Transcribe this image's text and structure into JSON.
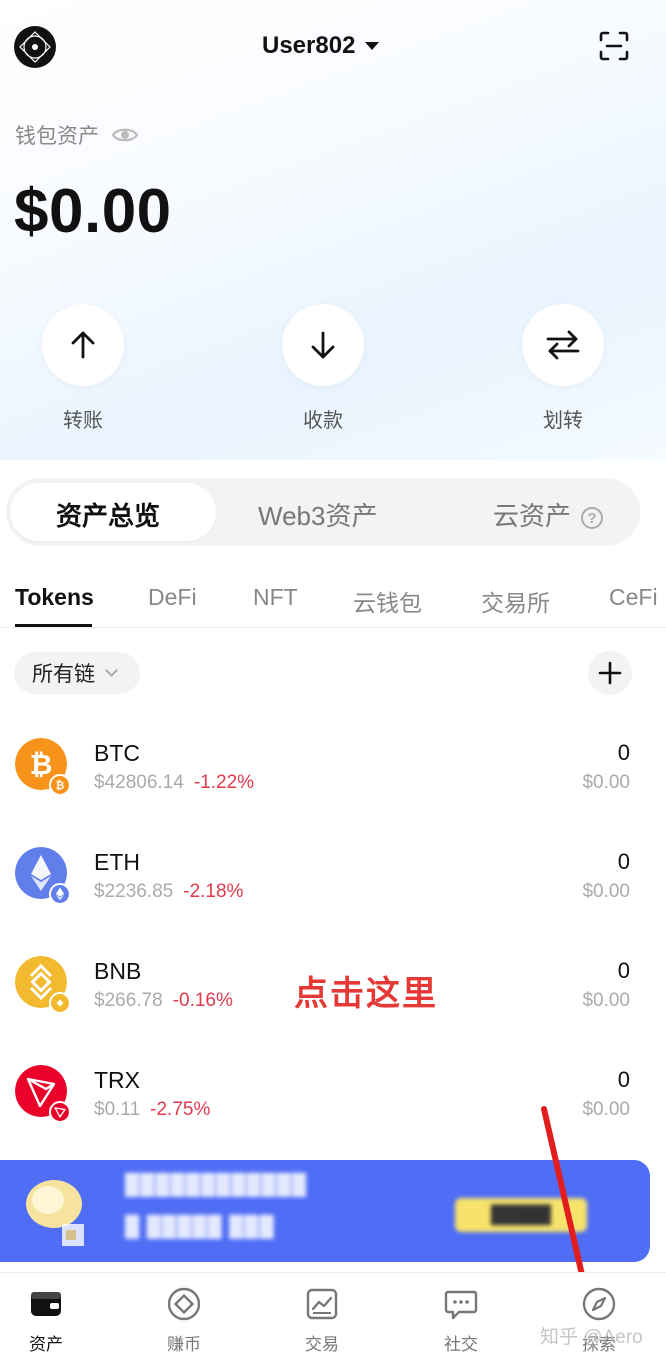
{
  "header": {
    "username": "User802",
    "icons": {
      "logo": "app-logo-icon",
      "scan": "scan-icon",
      "caret": "caret-down-icon"
    }
  },
  "wallet": {
    "label": "钱包资产",
    "balance": "$0.00",
    "visibility_icon": "eye-icon"
  },
  "actions": [
    {
      "label": "转账",
      "icon": "arrow-up-icon"
    },
    {
      "label": "收款",
      "icon": "arrow-down-icon"
    },
    {
      "label": "划转",
      "icon": "swap-icon"
    }
  ],
  "segments": {
    "items": [
      "资产总览",
      "Web3资产",
      "云资产"
    ],
    "active": "资产总览",
    "help_icon": "help-icon",
    "help_glyph": "?"
  },
  "subtabs": {
    "items": [
      "Tokens",
      "DeFi",
      "NFT",
      "云钱包",
      "交易所",
      "CeFi"
    ],
    "active": "Tokens"
  },
  "filter": {
    "chain_label": "所有链",
    "add_glyph": "+"
  },
  "tokens": [
    {
      "symbol": "BTC",
      "price": "$42806.14",
      "change": "-1.22%",
      "amount": "0",
      "value": "$0.00",
      "color": "#f7931a"
    },
    {
      "symbol": "ETH",
      "price": "$2236.85",
      "change": "-2.18%",
      "amount": "0",
      "value": "$0.00",
      "color": "#627eea"
    },
    {
      "symbol": "BNB",
      "price": "$266.78",
      "change": "-0.16%",
      "amount": "0",
      "value": "$0.00",
      "color": "#f3ba2f"
    },
    {
      "symbol": "TRX",
      "price": "$0.11",
      "change": "-2.75%",
      "amount": "0",
      "value": "$0.00",
      "color": "#eb0029"
    }
  ],
  "annotation": "点击这里",
  "banner": {
    "line1": "████████████",
    "line2": "█ █████ ███",
    "button": "█████",
    "background": "#4f6df5"
  },
  "bottom_nav": [
    {
      "label": "资产",
      "icon": "wallet-icon",
      "active": true
    },
    {
      "label": "赚币",
      "icon": "earn-icon",
      "active": false
    },
    {
      "label": "交易",
      "icon": "trade-icon",
      "active": false
    },
    {
      "label": "社交",
      "icon": "chat-icon",
      "active": false
    },
    {
      "label": "探索",
      "icon": "compass-icon",
      "active": false
    }
  ],
  "watermark": "知乎 @Aero",
  "colors": {
    "negative": "#e03a4d",
    "annotation": "#e53935",
    "accent": "#111111"
  }
}
